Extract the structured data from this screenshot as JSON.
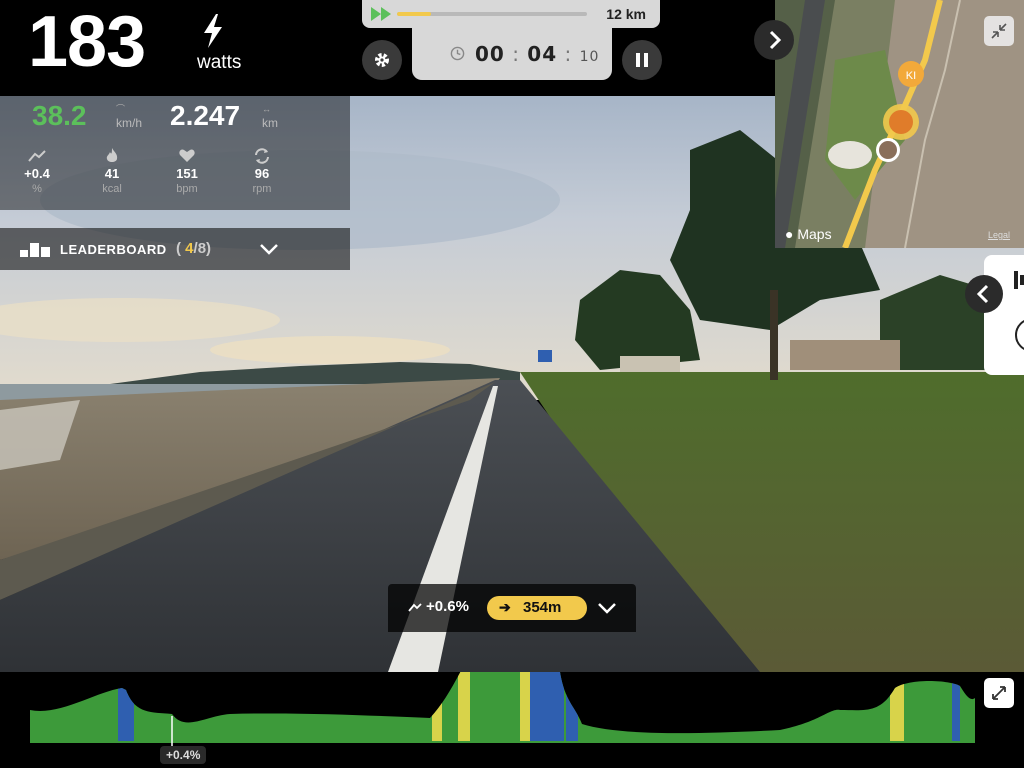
{
  "power": {
    "value": "183",
    "unit": "watts"
  },
  "route": {
    "distance_label": "12 km",
    "progress": 0.18
  },
  "timer": {
    "minutes_major": "00",
    "minutes": "04",
    "hundredths": "10"
  },
  "stats": {
    "speed": {
      "value": "38.2",
      "unit": "km/h"
    },
    "distance": {
      "value": "2.247",
      "unit": "km"
    },
    "metrics": [
      {
        "icon": "incline-icon",
        "value": "+0.4",
        "unit": "%"
      },
      {
        "icon": "flame-icon",
        "value": "41",
        "unit": "kcal"
      },
      {
        "icon": "heart-icon",
        "value": "151",
        "unit": "bpm"
      },
      {
        "icon": "cadence-icon",
        "value": "96",
        "unit": "rpm"
      }
    ]
  },
  "leaderboard": {
    "label": "LEADERBOARD",
    "position": "4",
    "total": "8"
  },
  "map": {
    "brand": "Maps",
    "legal": "Legal",
    "rider_initials": "KI"
  },
  "grade": {
    "current": "+0.6%",
    "next_distance": "354m"
  },
  "elevation": {
    "current_grade": "+0.4%"
  },
  "colors": {
    "accent": "#f2c94c",
    "speed": "#5cc05b",
    "elev_green": "#3d9a3a",
    "elev_yellow": "#d8d34a",
    "elev_blue": "#2f5fb0"
  }
}
